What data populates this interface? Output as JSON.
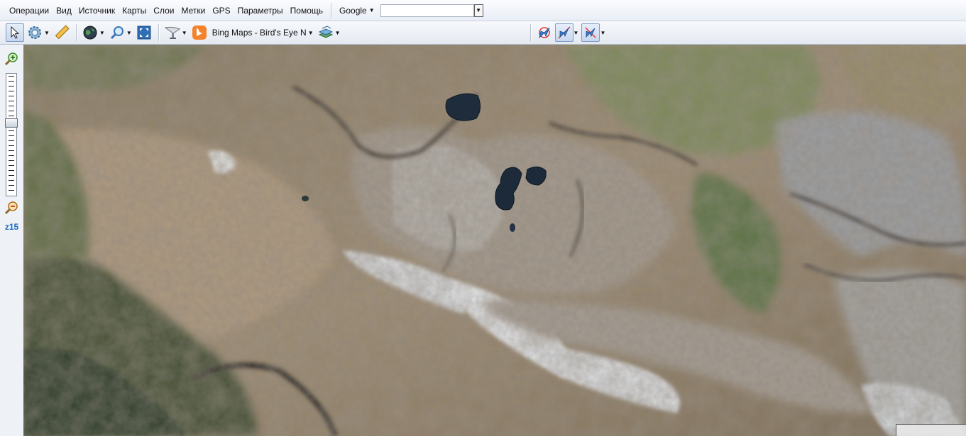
{
  "menu": {
    "items": [
      "Операции",
      "Вид",
      "Источник",
      "Карты",
      "Слои",
      "Метки",
      "GPS",
      "Параметры",
      "Помощь"
    ]
  },
  "search": {
    "provider": "Google",
    "value": ""
  },
  "toolbar": {
    "source_label": "Bing Maps - Bird's Eye N",
    "tools": [
      "select-arrow-icon",
      "gear-icon",
      "ruler-icon",
      "globe-icon",
      "magnifier-icon",
      "fullscreen-icon",
      "satellite-dish-icon",
      "bing-icon",
      "layers-icon",
      "gps-follow-icon",
      "gps-center-icon",
      "gps-track-icon"
    ]
  },
  "zoom": {
    "level_label": "z15"
  },
  "colors": {
    "accent": "#1769c4",
    "bing": "#f4822a"
  }
}
